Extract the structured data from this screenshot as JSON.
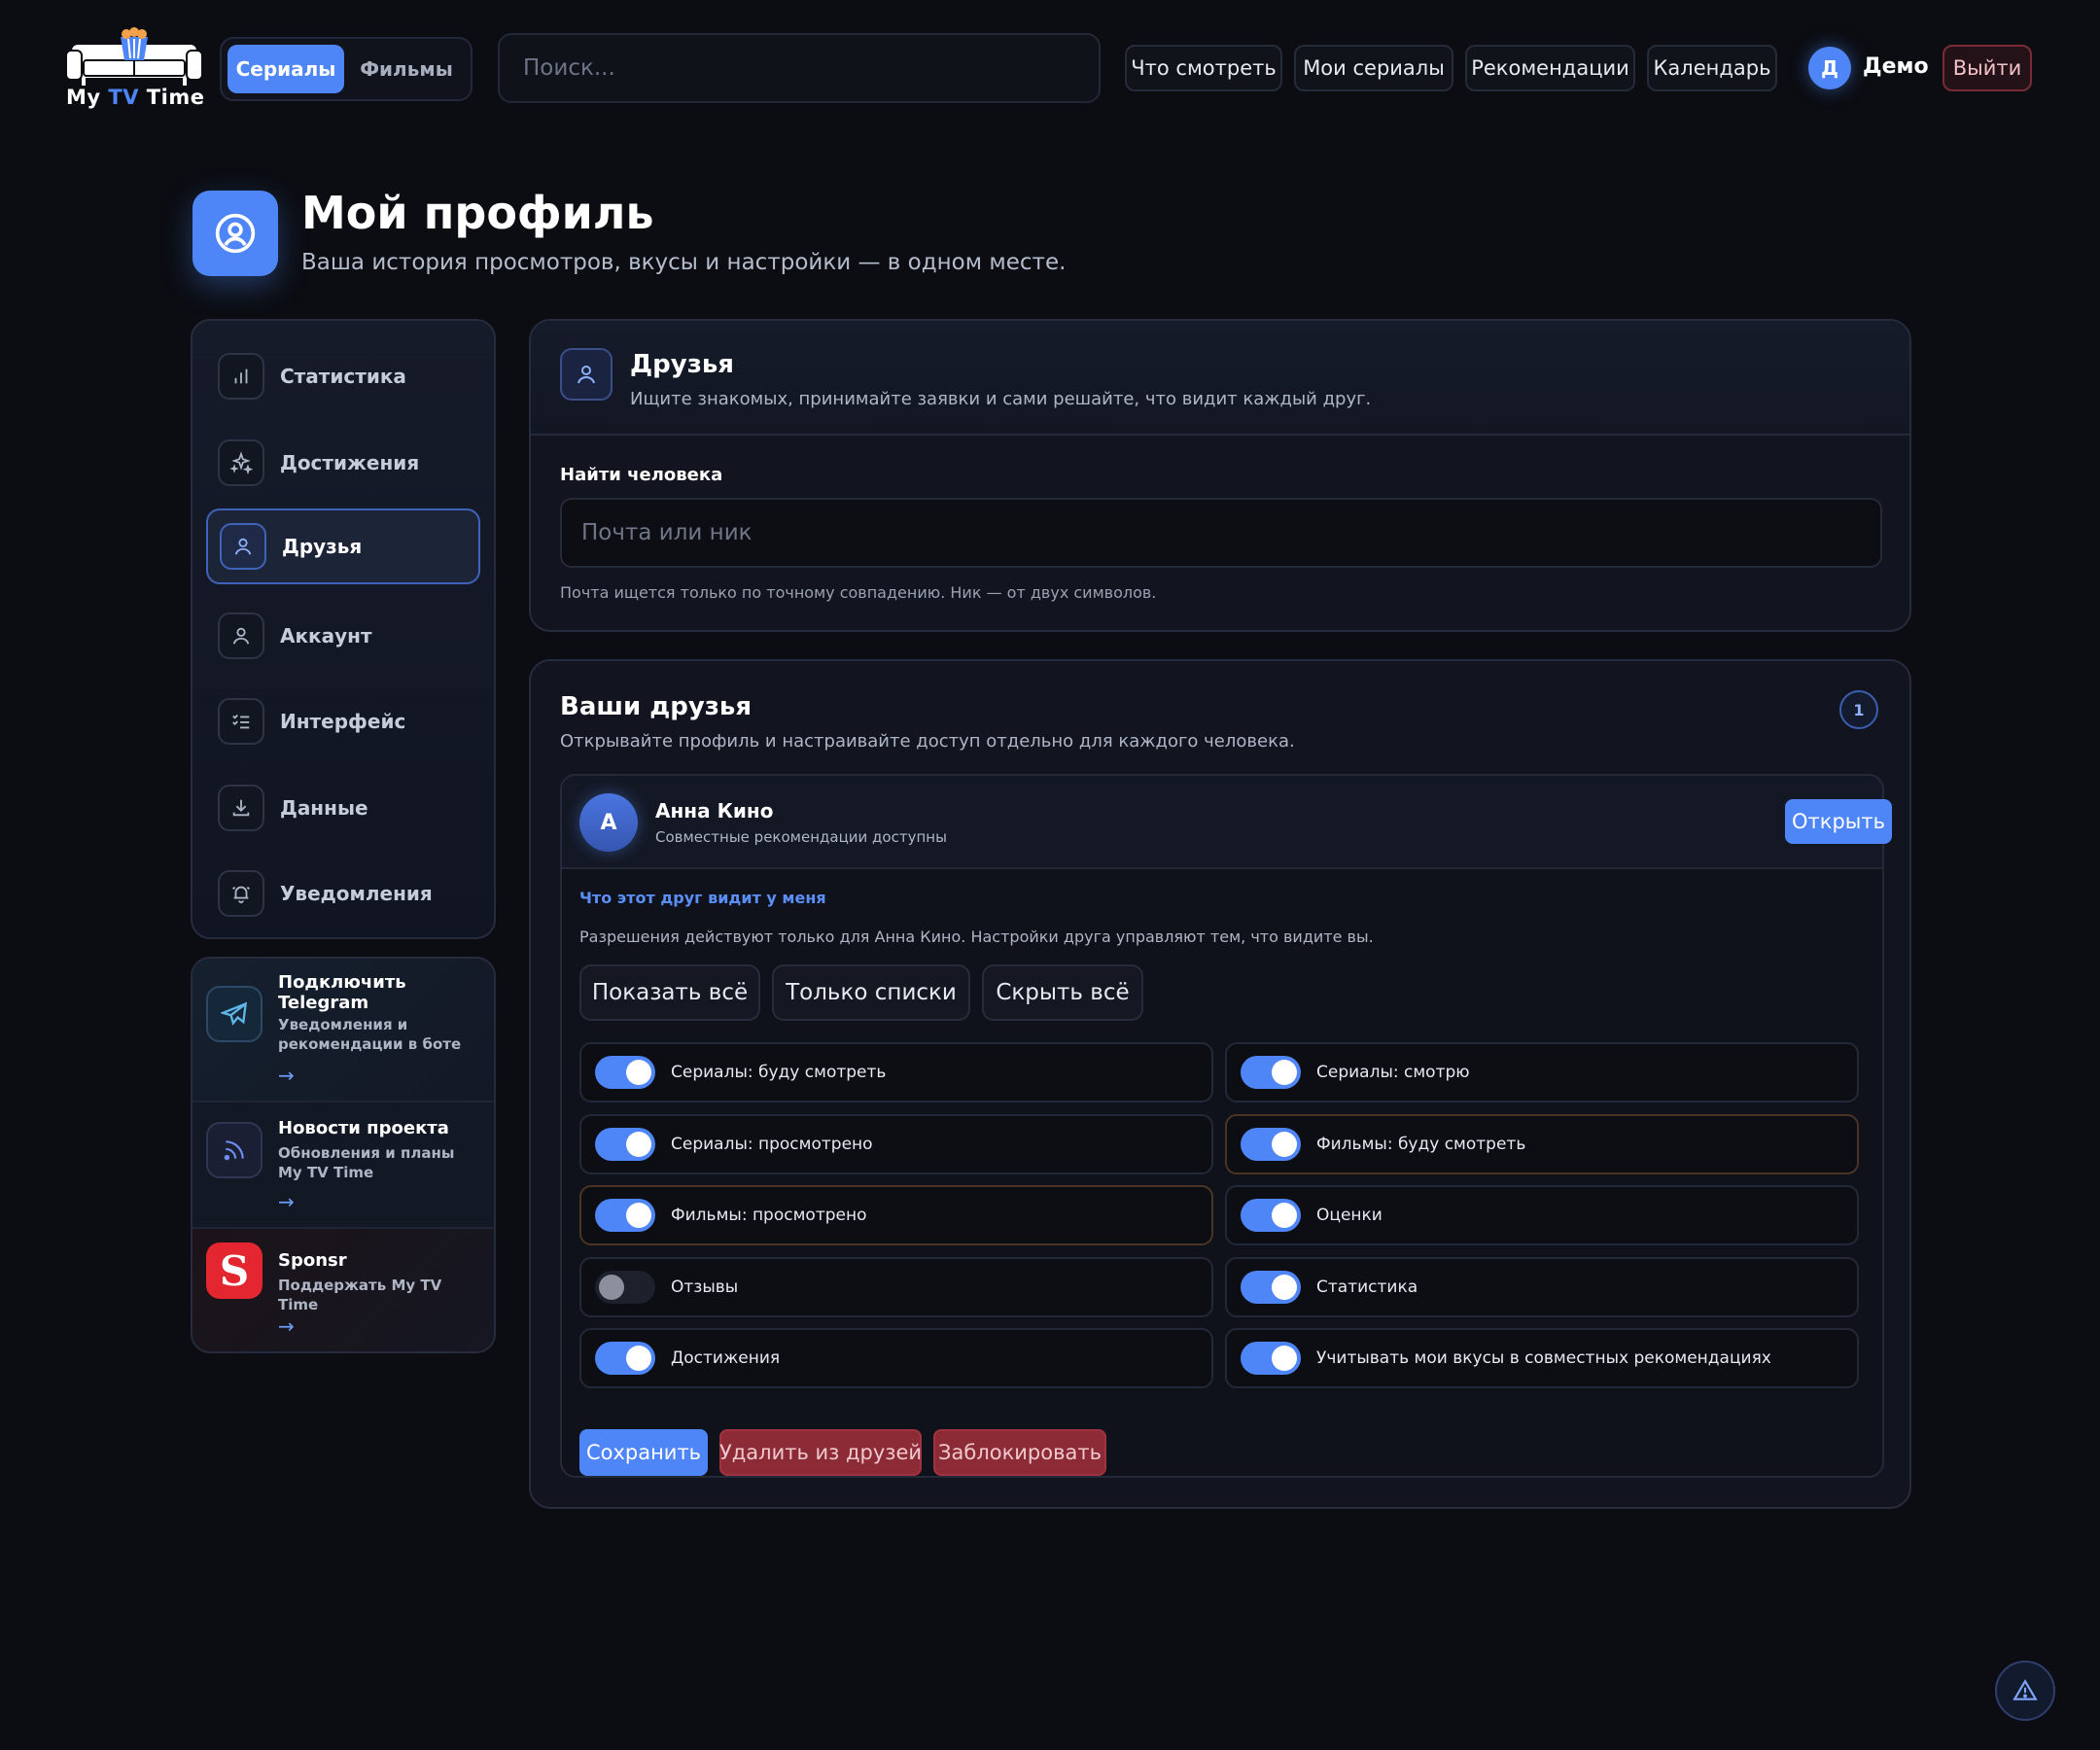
{
  "header": {
    "logo_text_my": "My",
    "logo_text_tv": "TV",
    "logo_text_time": "Time",
    "segments": [
      "Сериалы",
      "Фильмы"
    ],
    "active_segment": "Сериалы",
    "search_placeholder": "Поиск...",
    "nav": [
      "Что смотреть",
      "Мои сериалы",
      "Рекомендации",
      "Календарь"
    ],
    "user_initial": "Д",
    "user_name": "Демо",
    "logout_label": "Выйти"
  },
  "page": {
    "title": "Мой профиль",
    "subtitle": "Ваша история просмотров, вкусы и настройки — в одном месте."
  },
  "sidebar": {
    "items": [
      {
        "label": "Статистика",
        "icon": "bar-chart-icon"
      },
      {
        "label": "Достижения",
        "icon": "sparkles-icon"
      },
      {
        "label": "Друзья",
        "icon": "user-icon",
        "active": true
      },
      {
        "label": "Аккаунт",
        "icon": "account-icon"
      },
      {
        "label": "Интерфейс",
        "icon": "checklist-icon"
      },
      {
        "label": "Данные",
        "icon": "download-icon"
      },
      {
        "label": "Уведомления",
        "icon": "bell-icon"
      }
    ]
  },
  "promos": [
    {
      "title": "Подключить Telegram",
      "desc": "Уведомления и рекомендации в боте",
      "icon": "telegram-icon"
    },
    {
      "title": "Новости проекта",
      "desc": "Обновления и планы My TV Time",
      "icon": "rss-icon"
    },
    {
      "title": "Sponsr",
      "desc": "Поддержать My TV Time",
      "icon": "sponsr-logo",
      "logo_letter": "S"
    }
  ],
  "find": {
    "title": "Друзья",
    "subtitle": "Ищите знакомых, принимайте заявки и сами решайте, что видит каждый друг.",
    "label": "Найти человека",
    "placeholder": "Почта или ник",
    "hint": "Почта ищется только по точному совпадению. Ник — от двух символов."
  },
  "friends": {
    "title": "Ваши друзья",
    "subtitle": "Открывайте профиль и настраивайте доступ отдельно для каждого человека.",
    "count": "1",
    "friend": {
      "initial": "А",
      "name": "Анна Кино",
      "status": "Совместные рекомендации доступны",
      "open_label": "Открыть",
      "perm_title": "Что этот друг видит у меня",
      "perm_note": "Разрешения действуют только для Анна Кино. Настройки друга управляют тем, что видите вы.",
      "presets": [
        "Показать всё",
        "Только списки",
        "Скрыть всё"
      ],
      "toggles": [
        {
          "label": "Сериалы: буду смотреть",
          "on": true
        },
        {
          "label": "Сериалы: смотрю",
          "on": true
        },
        {
          "label": "Сериалы: просмотрено",
          "on": true
        },
        {
          "label": "Фильмы: буду смотреть",
          "on": true
        },
        {
          "label": "Фильмы: просмотрено",
          "on": true
        },
        {
          "label": "Оценки",
          "on": true
        },
        {
          "label": "Отзывы",
          "on": false
        },
        {
          "label": "Статистика",
          "on": true
        },
        {
          "label": "Достижения",
          "on": true
        },
        {
          "label": "Учитывать мои вкусы в совместных рекомендациях",
          "on": true
        }
      ],
      "actions": [
        "Сохранить",
        "Удалить из друзей",
        "Заблокировать"
      ]
    }
  },
  "colors": {
    "accent": "#4f86f7",
    "danger": "#8c2a36",
    "background": "#0b0d12"
  }
}
